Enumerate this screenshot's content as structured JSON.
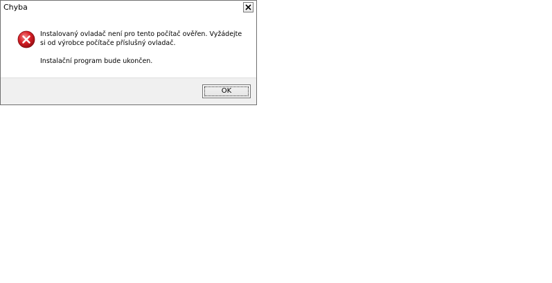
{
  "window": {
    "title": "Chyba",
    "close_glyph": "×"
  },
  "message": {
    "icon": "error-icon",
    "line1": "Instalovaný ovladač není pro tento počítač ověřen. Vyžádejte si od výrobce počítače příslušný ovladač.",
    "line2": "Instalační program bude ukončen."
  },
  "buttons": {
    "ok_label": "OK"
  },
  "colors": {
    "error_red": "#d81f26",
    "footer_bg": "#f0f0f0"
  }
}
